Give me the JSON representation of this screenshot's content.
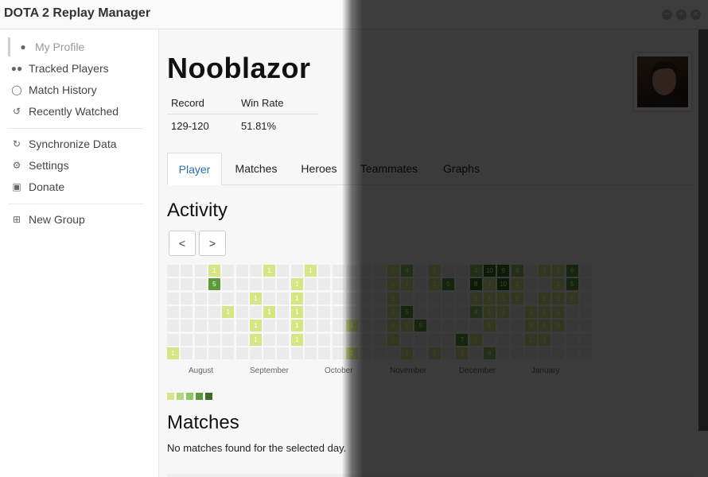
{
  "app": {
    "title": "DOTA 2 Replay Manager"
  },
  "window_controls": {
    "minimize": "−",
    "maximize": "+",
    "close": "×"
  },
  "sidebar": {
    "items": [
      {
        "label": "My Profile",
        "icon": "user-icon",
        "active": true
      },
      {
        "label": "Tracked Players",
        "icon": "users-icon"
      },
      {
        "label": "Match History",
        "icon": "gamepad-icon"
      },
      {
        "label": "Recently Watched",
        "icon": "history-icon"
      },
      {
        "label": "Synchronize Data",
        "icon": "refresh-icon"
      },
      {
        "label": "Settings",
        "icon": "gear-icon"
      },
      {
        "label": "Donate",
        "icon": "money-icon"
      },
      {
        "label": "New Group",
        "icon": "plus-square-icon"
      }
    ]
  },
  "profile": {
    "name": "Nooblazor",
    "record_label": "Record",
    "winrate_label": "Win Rate",
    "record": "129-120",
    "winrate": "51.81%"
  },
  "tabs": [
    "Player",
    "Matches",
    "Heroes",
    "Teammates",
    "Graphs"
  ],
  "activity": {
    "title": "Activity",
    "prev_label": "<",
    "next_label": ">",
    "months": [
      "August",
      "September",
      "October",
      "November",
      "December",
      "January"
    ],
    "colors": [
      "#ebebeb",
      "#d6e685",
      "#b5d67b",
      "#8cc665",
      "#5a9a3a",
      "#3b6e22"
    ],
    "weeks": [
      [
        0,
        0,
        0,
        0,
        0,
        0,
        1
      ],
      [
        0,
        0,
        0,
        0,
        0,
        0,
        0
      ],
      [
        0,
        0,
        0,
        0,
        0,
        0,
        0
      ],
      [
        1,
        5,
        0,
        0,
        0,
        0,
        0
      ],
      [
        0,
        0,
        0,
        1,
        0,
        0,
        0
      ],
      [
        0,
        0,
        0,
        0,
        0,
        0,
        0
      ],
      [
        0,
        0,
        1,
        0,
        1,
        1,
        0
      ],
      [
        1,
        0,
        0,
        1,
        0,
        0,
        0
      ],
      [
        0,
        0,
        0,
        0,
        0,
        0,
        0
      ],
      [
        0,
        1,
        1,
        1,
        1,
        1,
        0
      ],
      [
        1,
        0,
        0,
        0,
        0,
        0,
        0
      ],
      [
        0,
        0,
        0,
        0,
        0,
        0,
        0
      ],
      [
        0,
        0,
        0,
        0,
        0,
        0,
        0
      ],
      [
        0,
        0,
        0,
        0,
        1,
        0,
        1
      ],
      [
        0,
        0,
        0,
        0,
        0,
        0,
        0
      ],
      [
        0,
        0,
        0,
        0,
        0,
        0,
        0
      ],
      [
        1,
        1,
        1,
        1,
        1,
        1,
        0
      ],
      [
        4,
        1,
        0,
        5,
        1,
        0,
        1
      ],
      [
        0,
        0,
        0,
        0,
        5,
        0,
        0
      ],
      [
        1,
        1,
        0,
        0,
        0,
        0,
        1
      ],
      [
        0,
        5,
        0,
        0,
        0,
        0,
        0
      ],
      [
        0,
        0,
        0,
        0,
        0,
        7,
        1
      ],
      [
        4,
        8,
        1,
        4,
        0,
        1,
        0
      ],
      [
        10,
        1,
        1,
        1,
        1,
        0,
        4
      ],
      [
        9,
        10,
        1,
        1,
        0,
        0,
        0
      ],
      [
        4,
        1,
        1,
        0,
        0,
        0,
        0
      ],
      [
        0,
        0,
        0,
        1,
        1,
        1,
        0
      ],
      [
        1,
        0,
        1,
        1,
        1,
        1,
        0
      ],
      [
        1,
        1,
        1,
        1,
        1,
        0,
        0
      ],
      [
        6,
        5,
        1,
        0,
        0,
        0,
        0
      ],
      [
        0,
        0,
        0,
        0,
        0,
        0,
        0
      ]
    ]
  },
  "matches": {
    "title": "Matches",
    "empty_text": "No matches found for the selected day."
  }
}
